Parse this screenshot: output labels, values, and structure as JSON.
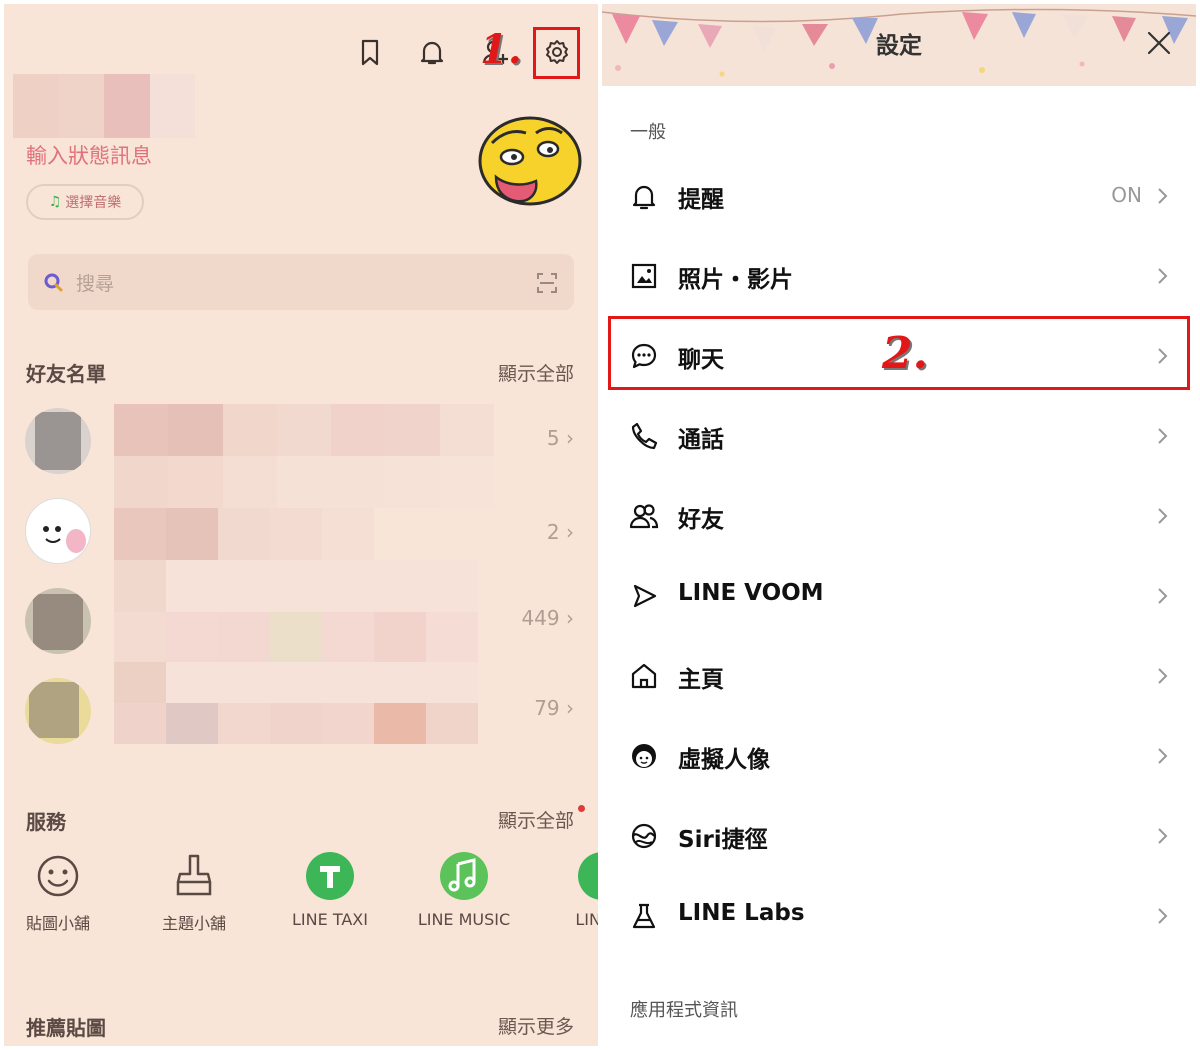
{
  "left": {
    "status_message": "輸入狀態訊息",
    "music_button": "選擇音樂",
    "search_placeholder": "搜尋",
    "friends_section": {
      "title": "好友名單",
      "more": "顯示全部",
      "rows": [
        {
          "count": "5"
        },
        {
          "count": "2"
        },
        {
          "count": "449"
        },
        {
          "count": "79"
        }
      ]
    },
    "services_section": {
      "title": "服務",
      "more": "顯示全部",
      "items": [
        {
          "label": "貼圖小舖"
        },
        {
          "label": "主題小舖"
        },
        {
          "label": "LINE TAXI"
        },
        {
          "label": "LINE MUSIC"
        },
        {
          "label": "LINE G"
        }
      ]
    },
    "stickers_section": {
      "title": "推薦貼圖",
      "more": "顯示更多"
    },
    "step_label": "1.",
    "accent_color": "#e21818"
  },
  "right": {
    "title": "設定",
    "group_general": "一般",
    "items": [
      {
        "label": "提醒",
        "value": "ON",
        "icon": "bell-icon"
      },
      {
        "label": "照片・影片",
        "value": "",
        "icon": "photo-icon"
      },
      {
        "label": "聊天",
        "value": "",
        "icon": "chat-bubble-icon"
      },
      {
        "label": "通話",
        "value": "",
        "icon": "phone-icon"
      },
      {
        "label": "好友",
        "value": "",
        "icon": "friends-icon"
      },
      {
        "label": "LINE VOOM",
        "value": "",
        "icon": "voom-icon"
      },
      {
        "label": "主頁",
        "value": "",
        "icon": "home-icon"
      },
      {
        "label": "虛擬人像",
        "value": "",
        "icon": "avatar-icon"
      },
      {
        "label": "Siri捷徑",
        "value": "",
        "icon": "siri-icon"
      },
      {
        "label": "LINE Labs",
        "value": "",
        "icon": "flask-icon"
      }
    ],
    "group_app_info": "應用程式資訊",
    "step_label": "2."
  }
}
